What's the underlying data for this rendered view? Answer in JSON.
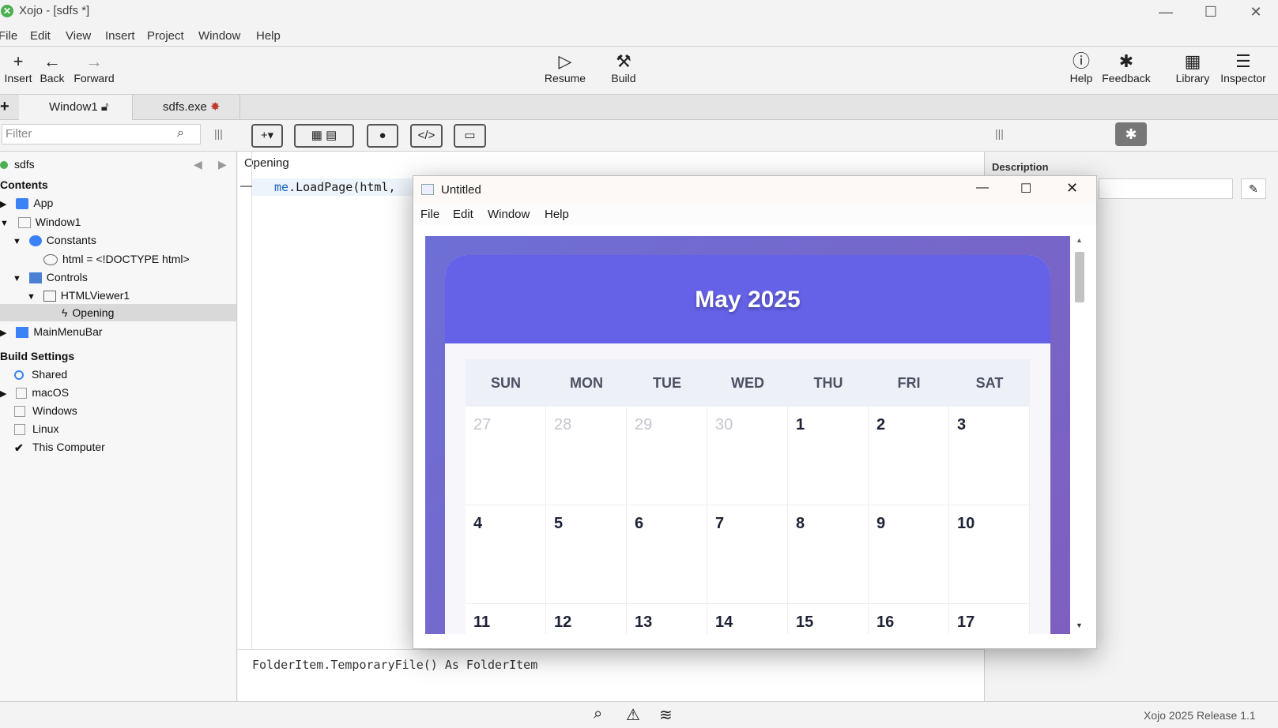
{
  "window": {
    "title": "Xojo - [sdfs *]"
  },
  "menu": [
    "File",
    "Edit",
    "View",
    "Insert",
    "Project",
    "Window",
    "Help"
  ],
  "toolbar": {
    "insert": "Insert",
    "back": "Back",
    "forward": "Forward",
    "resume": "Resume",
    "build": "Build",
    "help": "Help",
    "feedback": "Feedback",
    "library": "Library",
    "inspector": "Inspector"
  },
  "tabs": [
    "Window1",
    "sdfs.exe"
  ],
  "filter_placeholder": "Filter",
  "navigator": {
    "project": "sdfs",
    "contents_label": "Contents",
    "items": {
      "app": "App",
      "window1": "Window1",
      "constants": "Constants",
      "html_const": "html = <!DOCTYPE html>",
      "controls": "Controls",
      "htmlviewer": "HTMLViewer1",
      "opening": "Opening",
      "mainmenubar": "MainMenuBar"
    },
    "build_settings_label": "Build Settings",
    "build": {
      "shared": "Shared",
      "macos": "macOS",
      "windows": "Windows",
      "linux": "Linux",
      "this_computer": "This Computer"
    }
  },
  "editor": {
    "event_name": "Opening",
    "code_line": "me.LoadPage(html,",
    "code_me": "me",
    "code_rest": ".LoadPage(html,",
    "hint": "FolderItem.TemporaryFile() As FolderItem"
  },
  "inspector": {
    "description_label": "Description"
  },
  "dialog": {
    "title": "Untitled",
    "menu": [
      "File",
      "Edit",
      "Window",
      "Help"
    ]
  },
  "calendar": {
    "month": "May 2025",
    "days_of_week": [
      "SUN",
      "MON",
      "TUE",
      "WED",
      "THU",
      "FRI",
      "SAT"
    ],
    "weeks": [
      [
        {
          "d": "27",
          "other": true
        },
        {
          "d": "28",
          "other": true
        },
        {
          "d": "29",
          "other": true
        },
        {
          "d": "30",
          "other": true
        },
        {
          "d": "1"
        },
        {
          "d": "2"
        },
        {
          "d": "3"
        }
      ],
      [
        {
          "d": "4"
        },
        {
          "d": "5"
        },
        {
          "d": "6"
        },
        {
          "d": "7"
        },
        {
          "d": "8"
        },
        {
          "d": "9"
        },
        {
          "d": "10"
        }
      ],
      [
        {
          "d": "11"
        },
        {
          "d": "12"
        },
        {
          "d": "13"
        },
        {
          "d": "14"
        },
        {
          "d": "15"
        },
        {
          "d": "16"
        },
        {
          "d": "17"
        }
      ]
    ]
  },
  "status": {
    "version": "Xojo 2025 Release 1.1"
  },
  "colors": {
    "calendar_header": "#6562e8",
    "accent": "#4caf50"
  }
}
